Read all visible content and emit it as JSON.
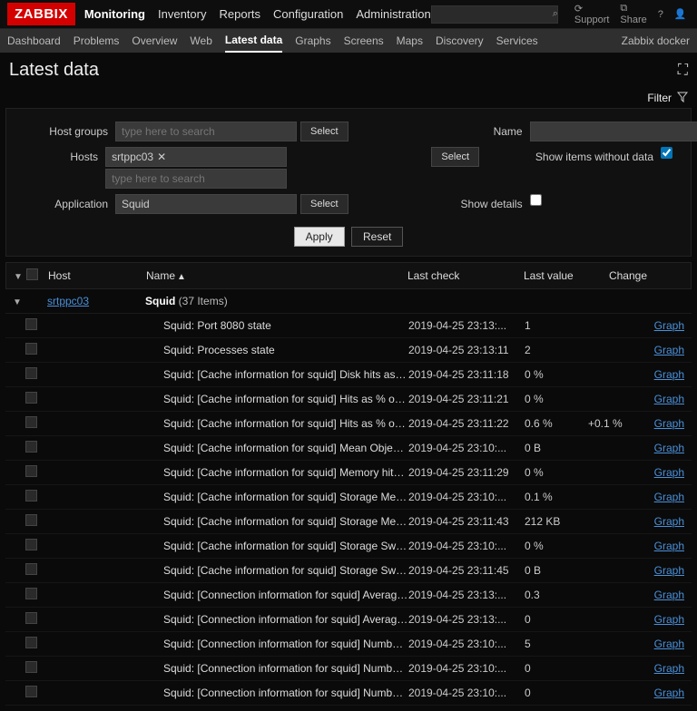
{
  "logo": "ZABBIX",
  "mainNav": [
    "Monitoring",
    "Inventory",
    "Reports",
    "Configuration",
    "Administration"
  ],
  "mainNavActive": "Monitoring",
  "topRight": {
    "support": "Support",
    "share": "Share"
  },
  "subNav": [
    "Dashboard",
    "Problems",
    "Overview",
    "Web",
    "Latest data",
    "Graphs",
    "Screens",
    "Maps",
    "Discovery",
    "Services"
  ],
  "subNavActive": "Latest data",
  "subNavRight": "Zabbix docker",
  "pageTitle": "Latest data",
  "filterLabel": "Filter",
  "filter": {
    "hostGroups": {
      "label": "Host groups",
      "placeholder": "type here to search",
      "select": "Select"
    },
    "hosts": {
      "label": "Hosts",
      "tag": "srtppc03",
      "placeholder": "type here to search",
      "select": "Select"
    },
    "application": {
      "label": "Application",
      "value": "Squid",
      "select": "Select"
    },
    "name": {
      "label": "Name",
      "value": ""
    },
    "showWithout": {
      "label": "Show items without data",
      "checked": true
    },
    "showDetails": {
      "label": "Show details",
      "checked": false
    },
    "apply": "Apply",
    "reset": "Reset"
  },
  "columns": {
    "host": "Host",
    "name": "Name",
    "lastCheck": "Last check",
    "lastValue": "Last value",
    "change": "Change"
  },
  "group": {
    "host": "srtppc03",
    "app": "Squid",
    "count": "(37 Items)"
  },
  "graphLabel": "Graph",
  "rows": [
    {
      "name": "Squid: Port 8080 state",
      "lastCheck": "2019-04-25 23:13:...",
      "lastValue": "1",
      "change": ""
    },
    {
      "name": "Squid: Processes state",
      "lastCheck": "2019-04-25 23:13:11",
      "lastValue": "2",
      "change": ""
    },
    {
      "name": "Squid: [Cache information for squid] Disk hits as % of hit req...",
      "lastCheck": "2019-04-25 23:11:18",
      "lastValue": "0 %",
      "change": ""
    },
    {
      "name": "Squid: [Cache information for squid] Hits as % of all requests",
      "lastCheck": "2019-04-25 23:11:21",
      "lastValue": "0 %",
      "change": ""
    },
    {
      "name": "Squid: [Cache information for squid] Hits as % of bytes sent",
      "lastCheck": "2019-04-25 23:11:22",
      "lastValue": "0.6 %",
      "change": "+0.1 %"
    },
    {
      "name": "Squid: [Cache information for squid] Mean Object Size",
      "lastCheck": "2019-04-25 23:10:...",
      "lastValue": "0 B",
      "change": ""
    },
    {
      "name": "Squid: [Cache information for squid] Memory hits as % of hit...",
      "lastCheck": "2019-04-25 23:11:29",
      "lastValue": "0 %",
      "change": ""
    },
    {
      "name": "Squid: [Cache information for squid] Storage Mem capacity",
      "lastCheck": "2019-04-25 23:10:...",
      "lastValue": "0.1 %",
      "change": ""
    },
    {
      "name": "Squid: [Cache information for squid] Storage Mem size",
      "lastCheck": "2019-04-25 23:11:43",
      "lastValue": "212 KB",
      "change": ""
    },
    {
      "name": "Squid: [Cache information for squid] Storage Swap capacity",
      "lastCheck": "2019-04-25 23:10:...",
      "lastValue": "0 %",
      "change": ""
    },
    {
      "name": "Squid: [Cache information for squid] Storage Swap size",
      "lastCheck": "2019-04-25 23:11:45",
      "lastValue": "0 B",
      "change": ""
    },
    {
      "name": "Squid: [Connection information for squid] Average HTTP req...",
      "lastCheck": "2019-04-25 23:13:...",
      "lastValue": "0.3",
      "change": ""
    },
    {
      "name": "Squid: [Connection information for squid] Average ICP mess...",
      "lastCheck": "2019-04-25 23:13:...",
      "lastValue": "0",
      "change": ""
    },
    {
      "name": "Squid: [Connection information for squid] Number of clients ...",
      "lastCheck": "2019-04-25 23:10:...",
      "lastValue": "5",
      "change": ""
    },
    {
      "name": "Squid: [Connection information for squid] Number of HTCP ...",
      "lastCheck": "2019-04-25 23:10:...",
      "lastValue": "0",
      "change": ""
    },
    {
      "name": "Squid: [Connection information for squid] Number of HTCP ...",
      "lastCheck": "2019-04-25 23:10:...",
      "lastValue": "0",
      "change": ""
    }
  ]
}
